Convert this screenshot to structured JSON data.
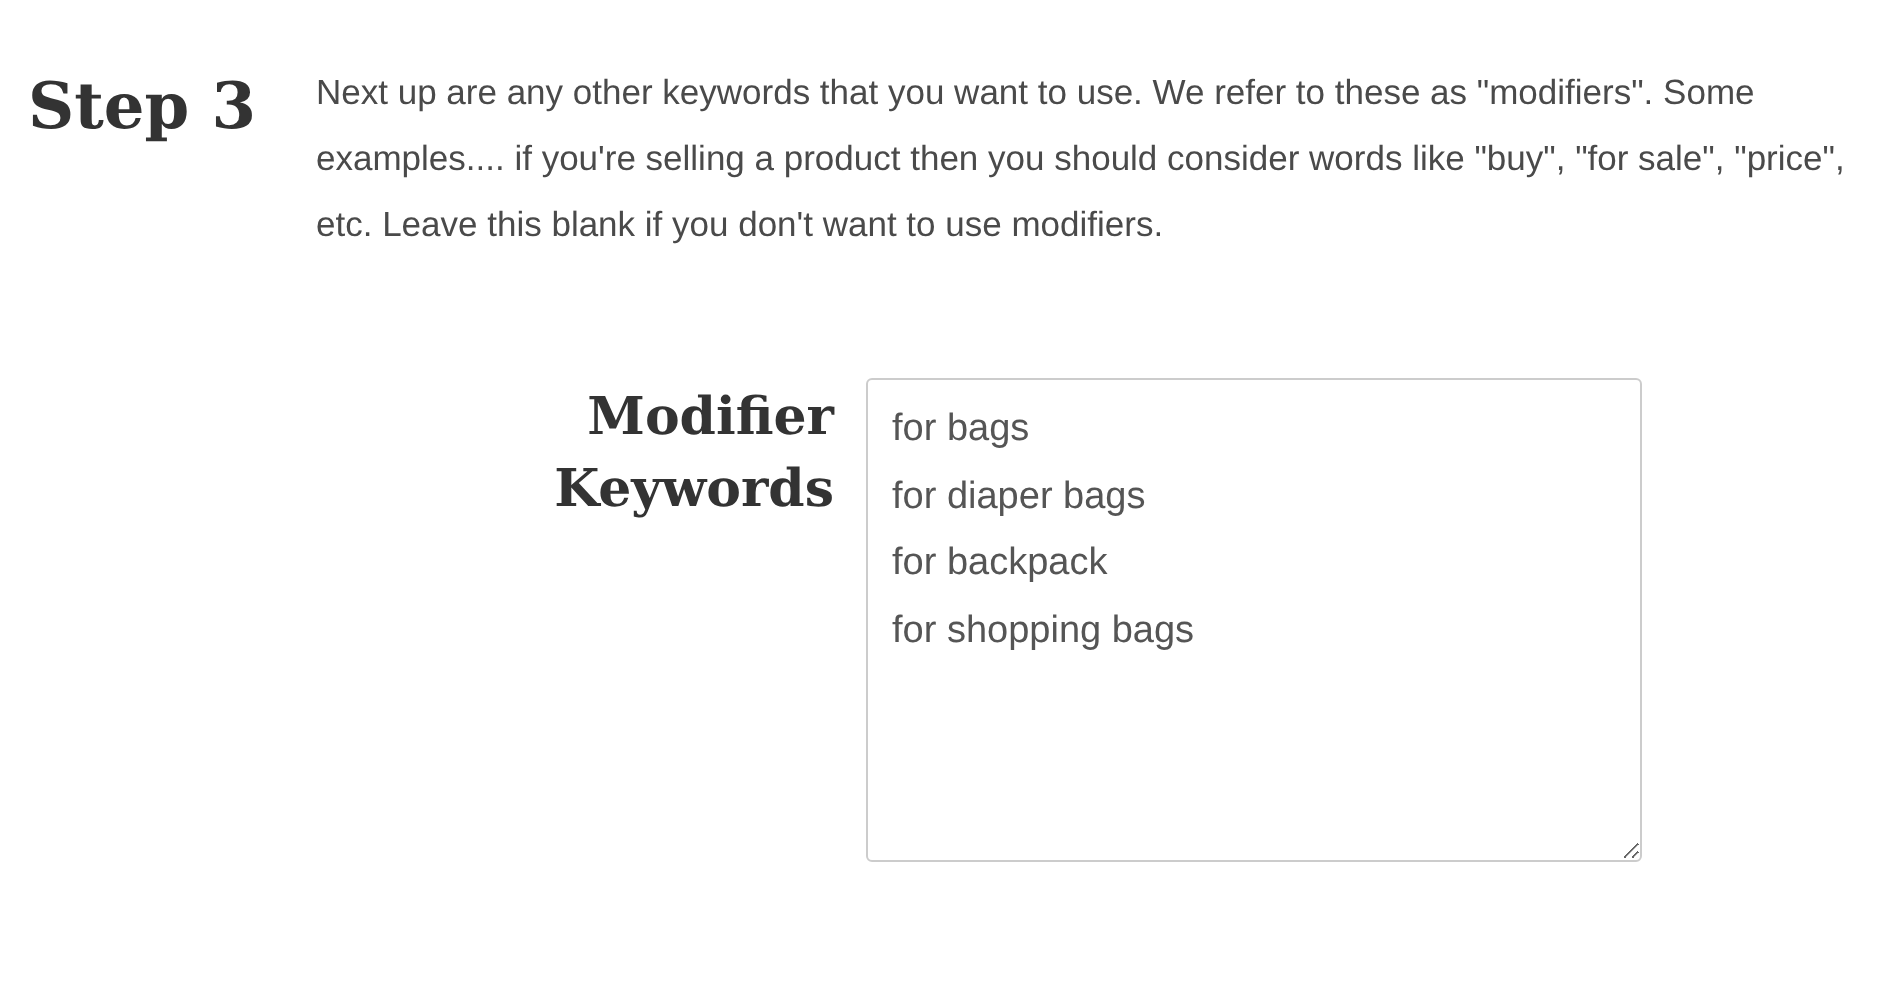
{
  "step": {
    "title": "Step 3",
    "description": "Next up are any other keywords that you want to use. We refer to these as \"modifiers\". Some examples.... if you're selling a product then you should consider words like \"buy\", \"for sale\", \"price\", etc. Leave this blank if you don't want to use modifiers."
  },
  "field": {
    "label": "Modifier Keywords",
    "lines": [
      "for bags",
      "for diaper bags",
      "for backpack",
      "for shopping bags"
    ]
  }
}
